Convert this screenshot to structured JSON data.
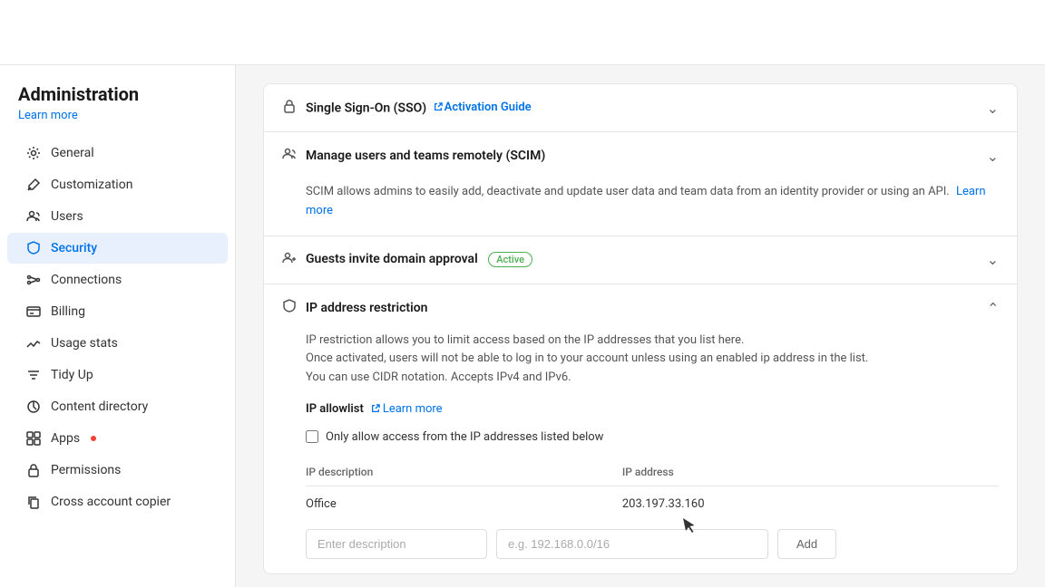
{
  "app": {
    "title": "Administration",
    "learn_more_label": "Learn more"
  },
  "sidebar": {
    "items": [
      {
        "id": "general",
        "label": "General",
        "icon": "settings"
      },
      {
        "id": "customization",
        "label": "Customization",
        "icon": "brush"
      },
      {
        "id": "users",
        "label": "Users",
        "icon": "users"
      },
      {
        "id": "security",
        "label": "Security",
        "icon": "shield",
        "active": true
      },
      {
        "id": "connections",
        "label": "Connections",
        "icon": "connections"
      },
      {
        "id": "billing",
        "label": "Billing",
        "icon": "billing"
      },
      {
        "id": "usage-stats",
        "label": "Usage stats",
        "icon": "chart"
      },
      {
        "id": "tidy-up",
        "label": "Tidy Up",
        "icon": "tidy"
      },
      {
        "id": "content-directory",
        "label": "Content directory",
        "icon": "directory"
      },
      {
        "id": "apps",
        "label": "Apps",
        "icon": "apps",
        "badge": true
      },
      {
        "id": "permissions",
        "label": "Permissions",
        "icon": "lock"
      },
      {
        "id": "cross-account-copier",
        "label": "Cross account copier",
        "icon": "copy"
      }
    ]
  },
  "main": {
    "sections": [
      {
        "id": "sso",
        "title": "Single Sign-On (SSO)",
        "link_label": "Activation Guide",
        "collapsed": true,
        "icon": "lock"
      },
      {
        "id": "scim",
        "title": "Manage users and teams remotely (SCIM)",
        "collapsed": true,
        "icon": "users",
        "body": "SCIM allows admins to easily add, deactivate and update user data and team data from an identity provider or using an API.",
        "learn_more_label": "Learn more"
      },
      {
        "id": "guests",
        "title": "Guests invite domain approval",
        "badge_label": "Active",
        "collapsed": true,
        "icon": "users"
      },
      {
        "id": "ip-restriction",
        "title": "IP address restriction",
        "collapsed": false,
        "icon": "shield",
        "description_lines": [
          "IP restriction allows you to limit access based on the IP addresses that you list here.",
          "Once activated, users will not be able to log in to your account unless using an enabled ip address in the list.",
          "You can use CIDR notation. Accepts IPv4 and IPv6."
        ],
        "allowlist_label": "IP allowlist",
        "learn_more_label": "Learn more",
        "checkbox_label": "Only allow access from the IP addresses listed below",
        "table": {
          "headers": [
            "IP description",
            "IP address"
          ],
          "rows": [
            {
              "description": "Office",
              "address": "203.197.33.160"
            }
          ]
        },
        "inputs": {
          "description_placeholder": "Enter description",
          "address_placeholder": "e.g. 192.168.0.0/16"
        },
        "add_button_label": "Add"
      }
    ]
  }
}
